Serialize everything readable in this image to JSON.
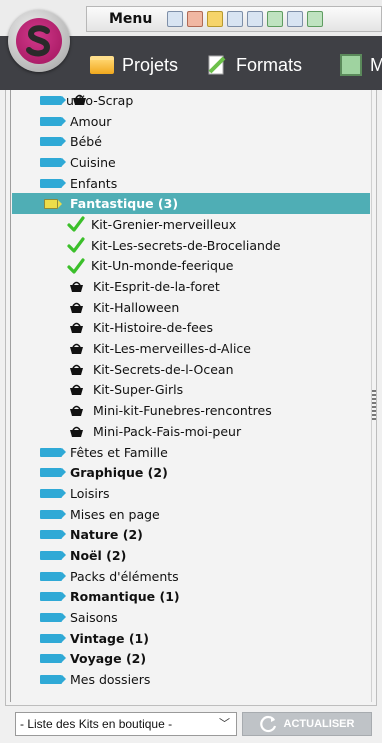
{
  "menubar": {
    "label": "Menu"
  },
  "tabs": [
    {
      "label": "Projets",
      "icon": "folder-icon"
    },
    {
      "label": "Formats",
      "icon": "formats-icon"
    },
    {
      "label": "M",
      "icon": "grid-icon"
    }
  ],
  "tree": {
    "items": [
      {
        "label": "udio-Scrap",
        "type": "cat",
        "icon": "basket-overlay"
      },
      {
        "label": "Amour",
        "type": "cat"
      },
      {
        "label": "Bébé",
        "type": "cat"
      },
      {
        "label": "Cuisine",
        "type": "cat"
      },
      {
        "label": "Enfants",
        "type": "cat"
      },
      {
        "label": "Fantastique (3)",
        "type": "cat",
        "bold": true,
        "selected": true,
        "expanded": true
      },
      {
        "label": "Kit-Grenier-merveilleux",
        "type": "kit",
        "status": "owned"
      },
      {
        "label": "Kit-Les-secrets-de-Broceliande",
        "type": "kit",
        "status": "owned"
      },
      {
        "label": "Kit-Un-monde-feerique",
        "type": "kit",
        "status": "owned"
      },
      {
        "label": "Kit-Esprit-de-la-foret",
        "type": "kit",
        "status": "shop"
      },
      {
        "label": "Kit-Halloween",
        "type": "kit",
        "status": "shop"
      },
      {
        "label": "Kit-Histoire-de-fees",
        "type": "kit",
        "status": "shop"
      },
      {
        "label": "Kit-Les-merveilles-d-Alice",
        "type": "kit",
        "status": "shop"
      },
      {
        "label": "Kit-Secrets-de-l-Ocean",
        "type": "kit",
        "status": "shop"
      },
      {
        "label": "Kit-Super-Girls",
        "type": "kit",
        "status": "shop"
      },
      {
        "label": "Mini-kit-Funebres-rencontres",
        "type": "kit",
        "status": "shop"
      },
      {
        "label": "Mini-Pack-Fais-moi-peur",
        "type": "kit",
        "status": "shop"
      },
      {
        "label": "Fêtes et Famille",
        "type": "cat"
      },
      {
        "label": "Graphique (2)",
        "type": "cat",
        "bold": true
      },
      {
        "label": "Loisirs",
        "type": "cat"
      },
      {
        "label": "Mises en page",
        "type": "cat"
      },
      {
        "label": "Nature (2)",
        "type": "cat",
        "bold": true
      },
      {
        "label": "Noël (2)",
        "type": "cat",
        "bold": true
      },
      {
        "label": "Packs d'éléments",
        "type": "cat"
      },
      {
        "label": "Romantique (1)",
        "type": "cat",
        "bold": true
      },
      {
        "label": "Saisons",
        "type": "cat"
      },
      {
        "label": "Vintage (1)",
        "type": "cat",
        "bold": true
      },
      {
        "label": "Voyage (2)",
        "type": "cat",
        "bold": true
      },
      {
        "label": "Mes dossiers",
        "type": "cat"
      }
    ]
  },
  "bottom": {
    "select_value": "- Liste des Kits en boutique -",
    "refresh_label": "ACTUALISER"
  },
  "colors": {
    "selected_row": "#4faeb5",
    "tag": "#2fa9d6",
    "check": "#3bbf2a",
    "logo": "#c01f74"
  }
}
